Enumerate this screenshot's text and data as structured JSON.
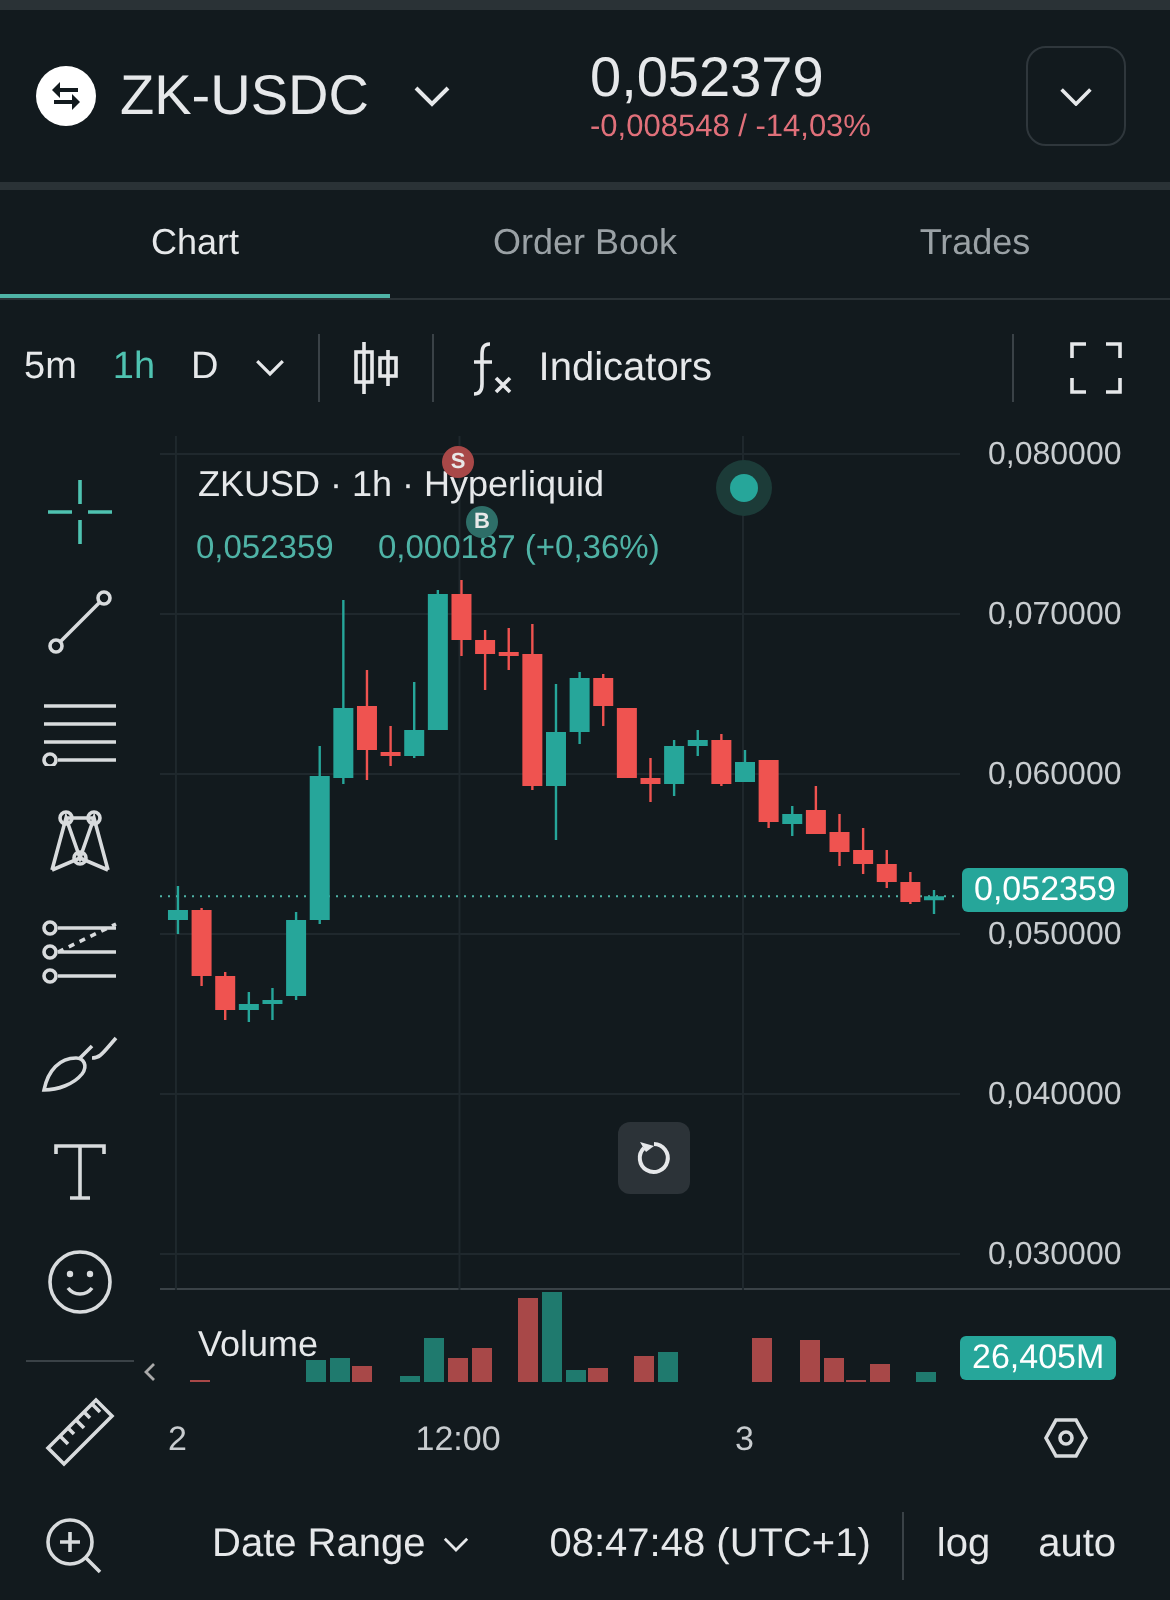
{
  "header": {
    "pair": "ZK-USDC",
    "price": "0,052379",
    "change": "-0,008548 / -14,03%"
  },
  "tabs": [
    {
      "label": "Chart",
      "selected": true
    },
    {
      "label": "Order Book",
      "selected": false
    },
    {
      "label": "Trades",
      "selected": false
    }
  ],
  "toolbar": {
    "intervals": [
      {
        "label": "5m",
        "selected": false
      },
      {
        "label": "1h",
        "selected": true
      },
      {
        "label": "D",
        "selected": false
      }
    ],
    "indicators": "Indicators"
  },
  "drawing_tools": [
    {
      "kind": "crosshair",
      "selected": true
    },
    {
      "kind": "line",
      "selected": false
    },
    {
      "kind": "lines",
      "selected": false
    },
    {
      "kind": "pattern",
      "selected": false
    },
    {
      "kind": "measure",
      "selected": false
    },
    {
      "kind": "brush",
      "selected": false
    },
    {
      "kind": "text",
      "selected": false
    },
    {
      "kind": "emoji",
      "selected": false
    }
  ],
  "chart": {
    "legend_title": "ZKUSD · 1h · Hyperliquid",
    "legend_values": [
      "0,052359",
      "0,000187 (+0,36%)"
    ],
    "markers": [
      {
        "label": "S",
        "kind": "sell"
      },
      {
        "label": "B",
        "kind": "buy"
      }
    ],
    "chart_data": {
      "type": "candlestick",
      "categories": [
        "2",
        null,
        null,
        null,
        null,
        null,
        null,
        null,
        null,
        null,
        null,
        null,
        "12:00",
        null,
        null,
        null,
        null,
        null,
        null,
        null,
        null,
        null,
        null,
        null,
        "3",
        null,
        null,
        null,
        null,
        null,
        null,
        null,
        null
      ],
      "ohlc": [
        [
          0.050875,
          0.053,
          0.05,
          0.0515
        ],
        [
          0.0515,
          0.051625,
          0.04675,
          0.047375
        ],
        [
          0.047375,
          0.047625,
          0.044625,
          0.04525
        ],
        [
          0.04525,
          0.046375,
          0.0445,
          0.045625
        ],
        [
          0.04575,
          0.046625,
          0.044625,
          0.045875
        ],
        [
          0.046125,
          0.051375,
          0.045875,
          0.050875
        ],
        [
          0.050875,
          0.06175,
          0.050625,
          0.059875
        ],
        [
          0.05975,
          0.070875,
          0.059375,
          0.064125
        ],
        [
          0.06425,
          0.0665,
          0.059625,
          0.0615
        ],
        [
          0.061375,
          0.063,
          0.0605,
          0.061125
        ],
        [
          0.061125,
          0.06575,
          0.061,
          0.06275
        ],
        [
          0.06275,
          0.0715,
          0.06275,
          0.07125
        ],
        [
          0.07125,
          0.072125,
          0.067375,
          0.068375
        ],
        [
          0.068375,
          0.069,
          0.06525,
          0.0675
        ],
        [
          0.067625,
          0.069125,
          0.0665,
          0.067375
        ],
        [
          0.0675,
          0.069375,
          0.059,
          0.05925
        ],
        [
          0.05925,
          0.065625,
          0.055875,
          0.062625
        ],
        [
          0.062625,
          0.066375,
          0.061875,
          0.066
        ],
        [
          0.066,
          0.06625,
          0.063,
          0.06425
        ],
        [
          0.064125,
          0.064125,
          0.05975,
          0.05975
        ],
        [
          0.05975,
          0.061,
          0.05825,
          0.059375
        ],
        [
          0.059375,
          0.062125,
          0.058625,
          0.06175
        ],
        [
          0.06175,
          0.06275,
          0.061125,
          0.062125
        ],
        [
          0.062125,
          0.0625,
          0.05925,
          0.059375
        ],
        [
          0.0595,
          0.0615,
          0.0595,
          0.06075
        ],
        [
          0.060875,
          0.060875,
          0.056625,
          0.057
        ],
        [
          0.056875,
          0.058,
          0.056125,
          0.0575
        ],
        [
          0.05775,
          0.05925,
          0.05625,
          0.05625
        ],
        [
          0.056375,
          0.0575,
          0.05425,
          0.055125
        ],
        [
          0.05525,
          0.056625,
          0.05375,
          0.054375
        ],
        [
          0.054375,
          0.05525,
          0.052875,
          0.05325
        ],
        [
          0.05325,
          0.053875,
          0.051875,
          0.052
        ],
        [
          0.0523,
          0.05275,
          0.05125,
          0.05236
        ]
      ],
      "ylim": [
        0.02775,
        0.081125
      ],
      "grid": true,
      "ref_lines": [
        {
          "axis": "y",
          "value": 0.05236
        }
      ],
      "yticks": [
        {
          "value": 0.08,
          "label": "0,080000"
        },
        {
          "value": 0.07,
          "label": "0,070000"
        },
        {
          "value": 0.06,
          "label": "0,060000"
        },
        {
          "value": 0.05,
          "label": "0,050000"
        },
        {
          "value": 0.04,
          "label": "0,040000"
        },
        {
          "value": 0.03,
          "label": "0,030000"
        }
      ]
    },
    "last_price": "0,052359",
    "volume_label": "Volume",
    "volume_value": "26,405M"
  },
  "footer": {
    "date_range": "Date Range",
    "time": "08:47:48 (UTC+1)",
    "buttons": [
      "log",
      "auto"
    ]
  }
}
